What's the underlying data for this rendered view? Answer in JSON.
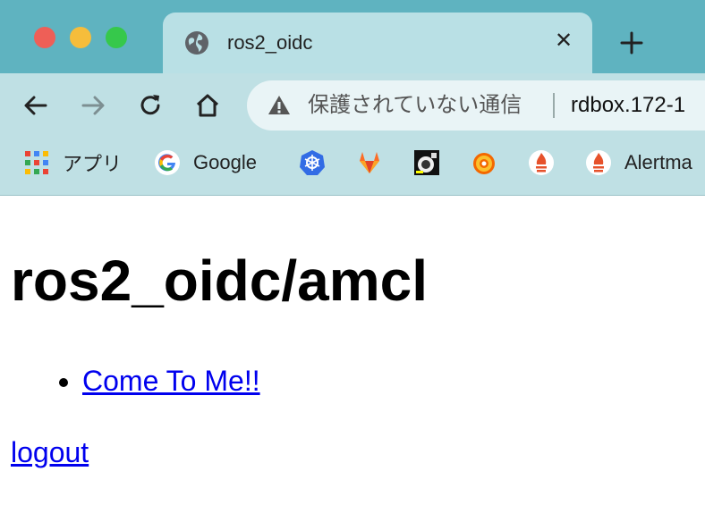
{
  "browser": {
    "tab": {
      "title": "ros2_oidc",
      "close_glyph": "✕"
    },
    "omnibox": {
      "security_text": "保護されていない通信",
      "url": "rdbox.172-1"
    },
    "bookmarks": [
      {
        "label": "アプリ",
        "icon": "apps-grid-icon"
      },
      {
        "label": "Google",
        "icon": "google-icon"
      },
      {
        "label": "",
        "icon": "kubernetes-icon"
      },
      {
        "label": "",
        "icon": "gitlab-icon"
      },
      {
        "label": "",
        "icon": "robot-icon"
      },
      {
        "label": "",
        "icon": "grafana-icon"
      },
      {
        "label": "",
        "icon": "prometheus-icon"
      },
      {
        "label": "Alertma",
        "icon": "alertmanager-icon"
      }
    ]
  },
  "page": {
    "heading": "ros2_oidc/amcl",
    "links": [
      {
        "label": "Come To Me!!"
      }
    ],
    "logout_label": "logout"
  },
  "colors": {
    "tabstrip": "#5fb3c0",
    "toolbar": "#bfe0e4",
    "link": "#0000ee"
  }
}
